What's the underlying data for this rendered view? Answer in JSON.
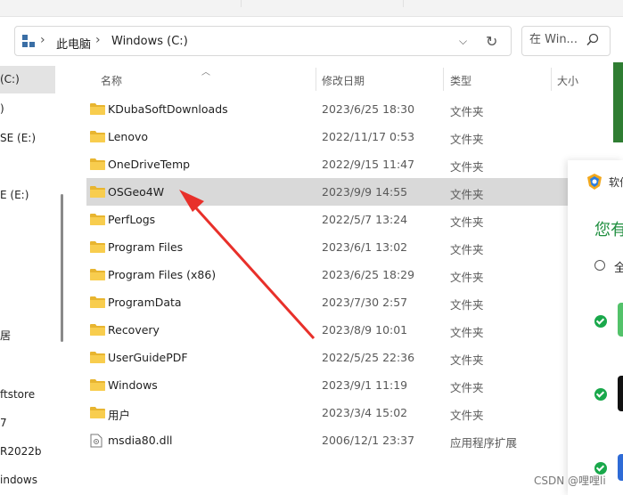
{
  "address": {
    "crumbs": [
      "此电脑",
      "Windows (C:)"
    ],
    "dropdown_icon": "chevron-down-icon",
    "refresh_icon": "refresh-icon"
  },
  "search": {
    "placeholder": "在 Win..."
  },
  "columns": {
    "name": "名称",
    "date": "修改日期",
    "type": "类型",
    "size": "大小"
  },
  "sidebar": {
    "items": [
      {
        "label": "(C:)",
        "selected": true
      },
      {
        "label": ")"
      },
      {
        "label": "SE (E:)"
      },
      {
        "label": ""
      },
      {
        "label": "E (E:)"
      },
      {
        "label": ""
      },
      {
        "label": ""
      },
      {
        "label": ""
      },
      {
        "label": ""
      },
      {
        "label": "居"
      },
      {
        "label": ""
      },
      {
        "label": "ftstore"
      },
      {
        "label": "7"
      },
      {
        "label": "R2022b"
      },
      {
        "label": "indows"
      }
    ]
  },
  "files": [
    {
      "name": "KDubaSoftDownloads",
      "date": "2023/6/25 18:30",
      "type": "文件夹",
      "icon": "folder-icon"
    },
    {
      "name": "Lenovo",
      "date": "2022/11/17 0:53",
      "type": "文件夹",
      "icon": "folder-icon"
    },
    {
      "name": "OneDriveTemp",
      "date": "2022/9/15 11:47",
      "type": "文件夹",
      "icon": "folder-icon"
    },
    {
      "name": "OSGeo4W",
      "date": "2023/9/9 14:55",
      "type": "文件夹",
      "icon": "folder-icon",
      "selected": true
    },
    {
      "name": "PerfLogs",
      "date": "2022/5/7 13:24",
      "type": "文件夹",
      "icon": "folder-icon"
    },
    {
      "name": "Program Files",
      "date": "2023/6/1 13:02",
      "type": "文件夹",
      "icon": "folder-icon"
    },
    {
      "name": "Program Files (x86)",
      "date": "2023/6/25 18:29",
      "type": "文件夹",
      "icon": "folder-icon"
    },
    {
      "name": "ProgramData",
      "date": "2023/7/30 2:57",
      "type": "文件夹",
      "icon": "folder-icon"
    },
    {
      "name": "Recovery",
      "date": "2023/8/9 10:01",
      "type": "文件夹",
      "icon": "folder-icon"
    },
    {
      "name": "UserGuidePDF",
      "date": "2022/5/25 22:36",
      "type": "文件夹",
      "icon": "folder-icon"
    },
    {
      "name": "Windows",
      "date": "2023/9/1 11:19",
      "type": "文件夹",
      "icon": "folder-icon"
    },
    {
      "name": "用户",
      "date": "2023/3/4 15:02",
      "type": "文件夹",
      "icon": "folder-icon"
    },
    {
      "name": "msdia80.dll",
      "date": "2006/12/1 23:37",
      "type": "应用程序扩展",
      "icon": "dll-file-icon"
    }
  ],
  "popup": {
    "title": "软件",
    "heading": "您有",
    "option": "全",
    "colors": {
      "accent": "#1e8e3e",
      "check": "#19a84b"
    }
  },
  "annotation": {
    "arrow_color": "#e8302a"
  },
  "watermark": "CSDN @哩哩li"
}
